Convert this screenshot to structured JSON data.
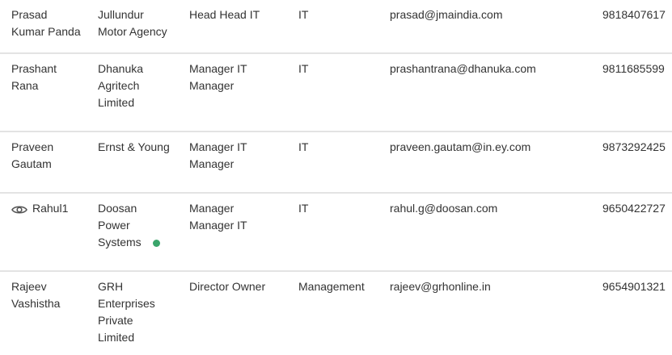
{
  "colors": {
    "status_online": "#3aa56b",
    "divider": "#e3e3e3",
    "text": "#333333"
  },
  "rows": [
    {
      "name_lines": [
        "Prasad",
        "Kumar Panda"
      ],
      "company_lines": [
        "Jullundur",
        "Motor Agency"
      ],
      "designation_lines": [
        "Head Head IT"
      ],
      "department": "IT",
      "email": "prasad@jmaindia.com",
      "phone": "9818407617"
    },
    {
      "name_lines": [
        "Prashant",
        "Rana"
      ],
      "company_lines": [
        "Dhanuka",
        "Agritech",
        "Limited"
      ],
      "designation_lines": [
        "Manager IT",
        "Manager"
      ],
      "department": "IT",
      "email": "prashantrana@dhanuka.com",
      "phone": "9811685599"
    },
    {
      "name_lines": [
        "Praveen",
        "Gautam"
      ],
      "company_lines": [
        "Ernst & Young"
      ],
      "designation_lines": [
        "Manager IT",
        "Manager"
      ],
      "department": "IT",
      "email": "praveen.gautam@in.ey.com",
      "phone": "9873292425"
    },
    {
      "name_lines": [
        "Rahul1"
      ],
      "name_icon": "eye-icon",
      "company_lines": [
        "Doosan",
        "Power",
        "Systems"
      ],
      "company_status": "online-status-dot",
      "designation_lines": [
        "Manager",
        "Manager IT"
      ],
      "department": "IT",
      "email": "rahul.g@doosan.com",
      "phone": "9650422727"
    },
    {
      "name_lines": [
        "Rajeev",
        "Vashistha"
      ],
      "company_lines": [
        "GRH",
        "Enterprises",
        "Private",
        "Limited"
      ],
      "designation_lines": [
        "Director Owner"
      ],
      "department": "Management",
      "email": "rajeev@grhonline.in",
      "phone": "9654901321"
    }
  ]
}
